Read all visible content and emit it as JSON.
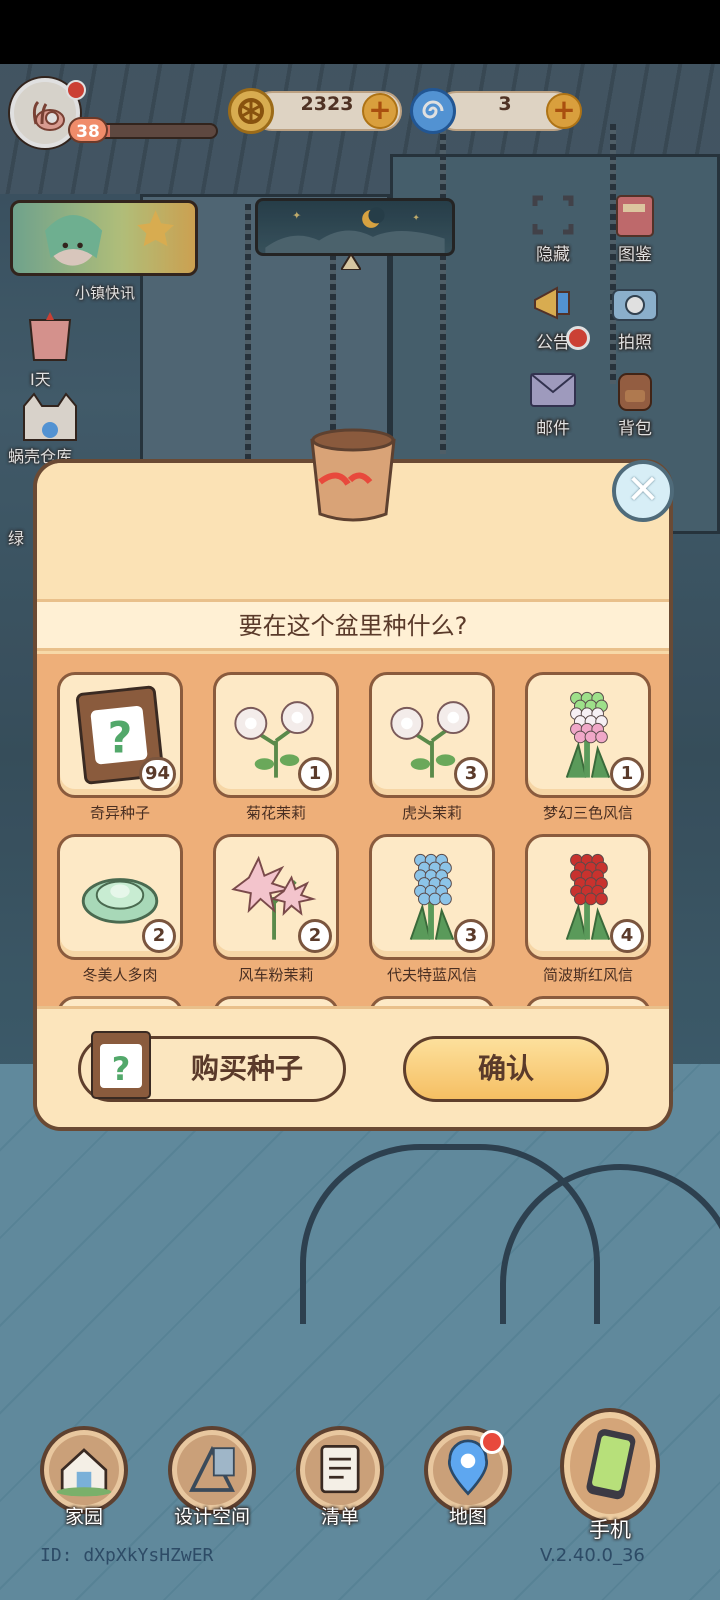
{
  "hud": {
    "level": "38",
    "xp_progress": 0.12,
    "coins": "2323",
    "gems": "3"
  },
  "left_widgets": {
    "news_label": "小镇快讯",
    "item2_label": "I天",
    "item3_label": "蜗壳仓库",
    "item4_label": "绿"
  },
  "right_menu": [
    {
      "label": "隐藏",
      "icon": "scan-frame-icon",
      "dot": false
    },
    {
      "label": "图鉴",
      "icon": "book-icon",
      "dot": false
    },
    {
      "label": "公告",
      "icon": "megaphone-icon",
      "dot": true
    },
    {
      "label": "拍照",
      "icon": "camera-icon",
      "dot": false
    },
    {
      "label": "邮件",
      "icon": "mail-icon",
      "dot": false
    },
    {
      "label": "背包",
      "icon": "backpack-icon",
      "dot": false
    }
  ],
  "modal": {
    "title": "要在这个盆里种什么?",
    "items": [
      {
        "name": "奇异种子",
        "count": "94",
        "icon": "mystery-seed-packet-icon",
        "color": "#8a5b3d"
      },
      {
        "name": "菊花茉莉",
        "count": "1",
        "icon": "white-jasmine-icon",
        "color": "#f3ecea"
      },
      {
        "name": "虎头茉莉",
        "count": "3",
        "icon": "white-jasmine-icon",
        "color": "#f3ecea"
      },
      {
        "name": "梦幻三色风信",
        "count": "1",
        "icon": "tricolor-hyacinth-icon",
        "color": "#f0a8c8"
      },
      {
        "name": "冬美人多肉",
        "count": "2",
        "icon": "succulent-icon",
        "color": "#a8d8b8"
      },
      {
        "name": "风车粉茉莉",
        "count": "2",
        "icon": "pink-jasmine-icon",
        "color": "#f3c4cc"
      },
      {
        "name": "代夫特蓝风信",
        "count": "3",
        "icon": "blue-hyacinth-icon",
        "color": "#8cc4e8"
      },
      {
        "name": "简波斯红风信",
        "count": "4",
        "icon": "red-hyacinth-icon",
        "color": "#c8322e"
      }
    ],
    "buy_button": "购买种子",
    "confirm_button": "确认"
  },
  "bottom_nav": [
    {
      "label": "家园",
      "icon": "house-icon"
    },
    {
      "label": "设计空间",
      "icon": "design-tools-icon"
    },
    {
      "label": "清单",
      "icon": "checklist-icon"
    },
    {
      "label": "地图",
      "icon": "map-pin-icon"
    }
  ],
  "phone_label": "手机",
  "player_id": "ID: dXpXkYsHZwER",
  "version": "V.2.40.0_36"
}
